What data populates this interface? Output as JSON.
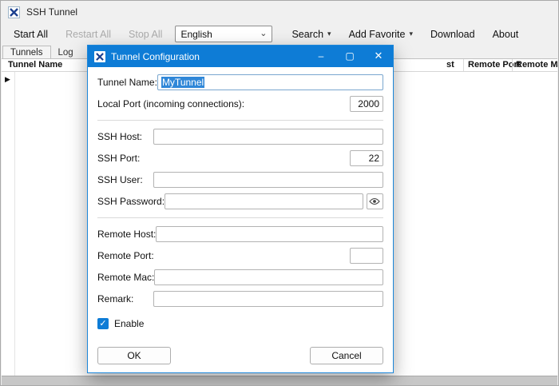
{
  "window": {
    "title": "SSH Tunnel"
  },
  "toolbar": {
    "start_all": "Start All",
    "restart_all": "Restart All",
    "stop_all": "Stop All",
    "language": "English",
    "search": "Search",
    "add_favorite": "Add Favorite",
    "download": "Download",
    "about": "About"
  },
  "tabs": [
    {
      "label": "Tunnels"
    },
    {
      "label": "Log"
    }
  ],
  "table": {
    "columns": [
      "Tunnel Name",
      "st",
      "Remote Port",
      "Remote Mac"
    ]
  },
  "icons": {
    "combo_arrow": "⌄",
    "dropdown_arrow": "▾",
    "row_pointer": "▶",
    "check": "✓",
    "minimize": "–",
    "maximize": "▢",
    "close": "✕"
  },
  "dialog": {
    "title": "Tunnel Configuration",
    "fields": {
      "tunnel_name": {
        "label": "Tunnel Name:",
        "value": "MyTunnel"
      },
      "local_port": {
        "label": "Local Port (incoming connections):",
        "value": "2000"
      },
      "ssh_host": {
        "label": "SSH Host:",
        "value": ""
      },
      "ssh_port": {
        "label": "SSH Port:",
        "value": "22"
      },
      "ssh_user": {
        "label": "SSH User:",
        "value": ""
      },
      "ssh_password": {
        "label": "SSH Password:",
        "value": ""
      },
      "remote_host": {
        "label": "Remote Host:",
        "value": ""
      },
      "remote_port": {
        "label": "Remote Port:",
        "value": ""
      },
      "remote_mac": {
        "label": "Remote Mac:",
        "value": ""
      },
      "remark": {
        "label": "Remark:",
        "value": ""
      }
    },
    "enable": {
      "label": "Enable",
      "checked": true
    },
    "buttons": {
      "ok": "OK",
      "cancel": "Cancel"
    }
  },
  "colors": {
    "accent": "#0e7cd6",
    "selection": "#2f87d8",
    "disabled_text": "#ababab"
  }
}
